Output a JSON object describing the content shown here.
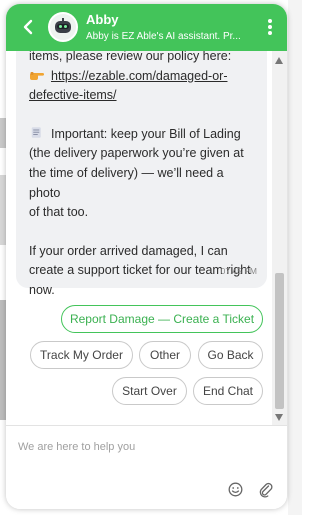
{
  "header": {
    "agent_name": "Abby",
    "agent_subtitle": "Abby is EZ Able's AI assistant. Pr...",
    "avatar_icon": "robot-avatar-icon",
    "back_icon": "chevron-left-icon",
    "menu_icon": "vertical-dots-icon",
    "color": "#43c45a"
  },
  "message": {
    "line_top": "items, please review our policy here:",
    "link_icon": "pointing-hand-icon",
    "link_line1": "https://ezable.com/damaged-or-",
    "link_line2": "defective-items/",
    "important_icon": "document-icon",
    "important_line1": "Important: keep your Bill of Lading",
    "important_line2": "(the delivery paperwork you’re given at",
    "important_line3": "the time of delivery) — we’ll need a photo",
    "important_line4": "of that too.",
    "offer_line1": "If your order arrived damaged, I can",
    "offer_line2": "create a support ticket for our team right",
    "offer_line3": "now.",
    "timestamp": "07:45 PM"
  },
  "quick_replies": {
    "report": "Report Damage — Create a Ticket",
    "track": "Track My Order",
    "other": "Other",
    "go_back": "Go Back",
    "start_over": "Start Over",
    "end_chat": "End Chat"
  },
  "composer": {
    "placeholder": "We are here to help you",
    "emoji_icon": "smiley-icon",
    "attach_icon": "paperclip-icon"
  }
}
